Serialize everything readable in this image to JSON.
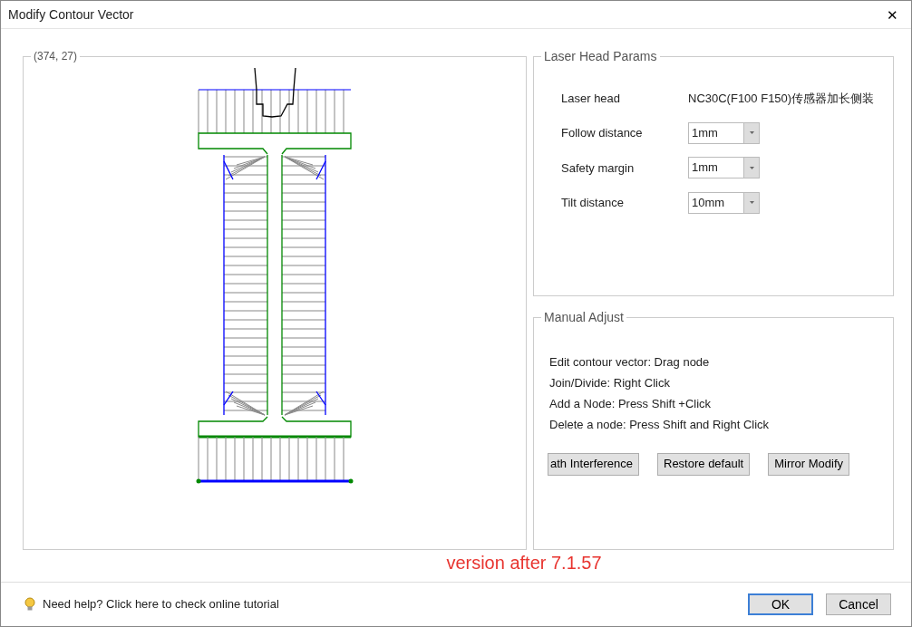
{
  "window": {
    "title": "Modify Contour Vector",
    "close": "✕"
  },
  "canvas": {
    "caption": "(374, 27)"
  },
  "laser_head_params": {
    "title": "Laser Head Params",
    "rows": [
      {
        "kind": "text",
        "label": "Laser head",
        "value": "NC30C(F100 F150)传感器加长侧装"
      },
      {
        "kind": "combo",
        "label": "Follow distance",
        "value": "1mm"
      },
      {
        "kind": "combo",
        "label": "Safety margin",
        "value": "1mm"
      },
      {
        "kind": "combo",
        "label": "Tilt distance",
        "value": "10mm"
      }
    ]
  },
  "manual_adjust": {
    "title": "Manual Adjust",
    "instructions": [
      "Edit contour vector: Drag node",
      "Join/Divide: Right Click",
      "Add a Node: Press Shift +Click",
      "Delete a node: Press Shift and Right Click"
    ],
    "buttons": [
      "ath Interference",
      "Restore default",
      "Mirror Modify"
    ]
  },
  "version_note": "version after 7.1.57",
  "footer": {
    "help_link": "Need help? Click here to check online tutorial",
    "buttons": [
      {
        "label": "OK",
        "default": true
      },
      {
        "label": "Cancel",
        "default": false
      }
    ]
  }
}
